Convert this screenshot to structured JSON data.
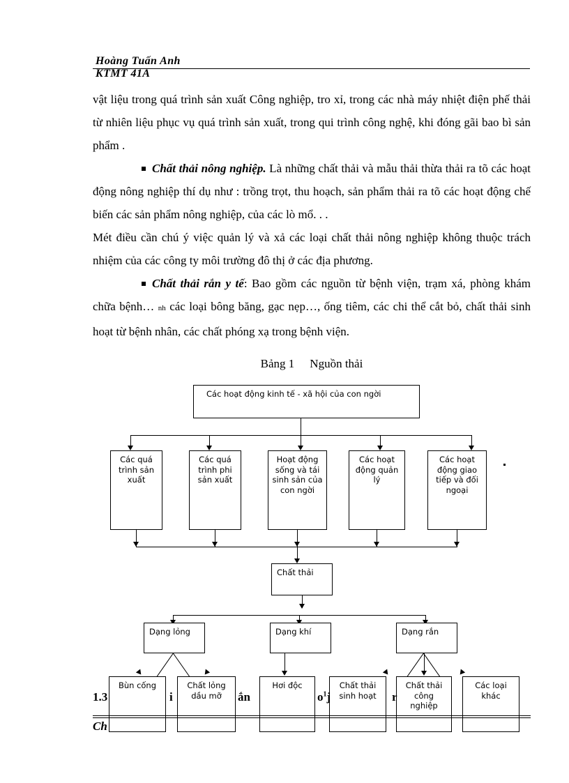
{
  "header": {
    "name": "Hoàng Tuấn Anh",
    "class": "KTMT 41A"
  },
  "body": {
    "paragraph_1": "vật liệu trong quá trình sản xuất Công nghiệp, tro xỉ, trong các nhà máy nhiệt điện phế thải từ nhiên liệu phục vụ quá trình sản xuất, trong qui trình công nghệ, khi đóng gãi bao bì sản phẩm .",
    "bullet_1": {
      "lead": "Chất thải nông nghiệp.",
      "text": " Là những chất thải và mẫu thải thừa thải ra tõ các hoạt động nông nghiệp thí dụ như : trồng trọt, thu hoạch, sản phẩm thải ra tõ các hoạt động chế biến các sản phẩm nông nghiệp, của các lò mổ. . ."
    },
    "paragraph_2": "Mét điều cần chú ý việc quản lý và xả các loại chất thải nông nghiệp không thuộc trách nhiệm của các công ty môi trường đô thị ở các địa phương.",
    "bullet_2": {
      "lead": "Chất thải rắn y tế",
      "text_a": ": Bao gồm các nguồn từ bệnh viện, trạm xá, phòng khám chữa bệnh… ",
      "tiny": "nh",
      "text_b": " các loại bông băng, gạc nẹp…, ống tiêm, các chi thể cắt bỏ, chất thải sinh hoạt từ bệnh nhân, các chất phóng xạ trong bệnh viện."
    }
  },
  "figure": {
    "caption_label": "Bảng 1",
    "caption_title": "Nguồn thải",
    "root": "Các hoạt động kinh tế - xã hội của con ngời",
    "level2": [
      "Các quá trình sản xuất",
      "Các quá trình phi sản xuất",
      "Hoạt động sống và tái sinh sản của con ngời",
      "Các hoạt động quản lý",
      "Các hoạt động giao tiếp và đối ngoại"
    ],
    "level3": "Chất thải",
    "level4": [
      "Dạng lỏng",
      "Dạng khí",
      "Dạng rắn"
    ],
    "level5": [
      "Bùn cống",
      "Chất lỏng dầu mỡ",
      "Hơi độc",
      "Chất thải sinh hoạt",
      "Chất thải công nghiệp",
      "Các loại khác"
    ],
    "stray_mark": "."
  },
  "footer": {
    "section_number": "1.3",
    "fragment_i": "i",
    "fragment_an": "ắn",
    "fragment_o1j": "o",
    "fragment_o1j_sup": "1",
    "fragment_o1j_tail": "j",
    "fragment_r": "r",
    "subtitle_visible": "Ch"
  },
  "colors": {
    "ink": "#000000",
    "page": "#ffffff"
  }
}
